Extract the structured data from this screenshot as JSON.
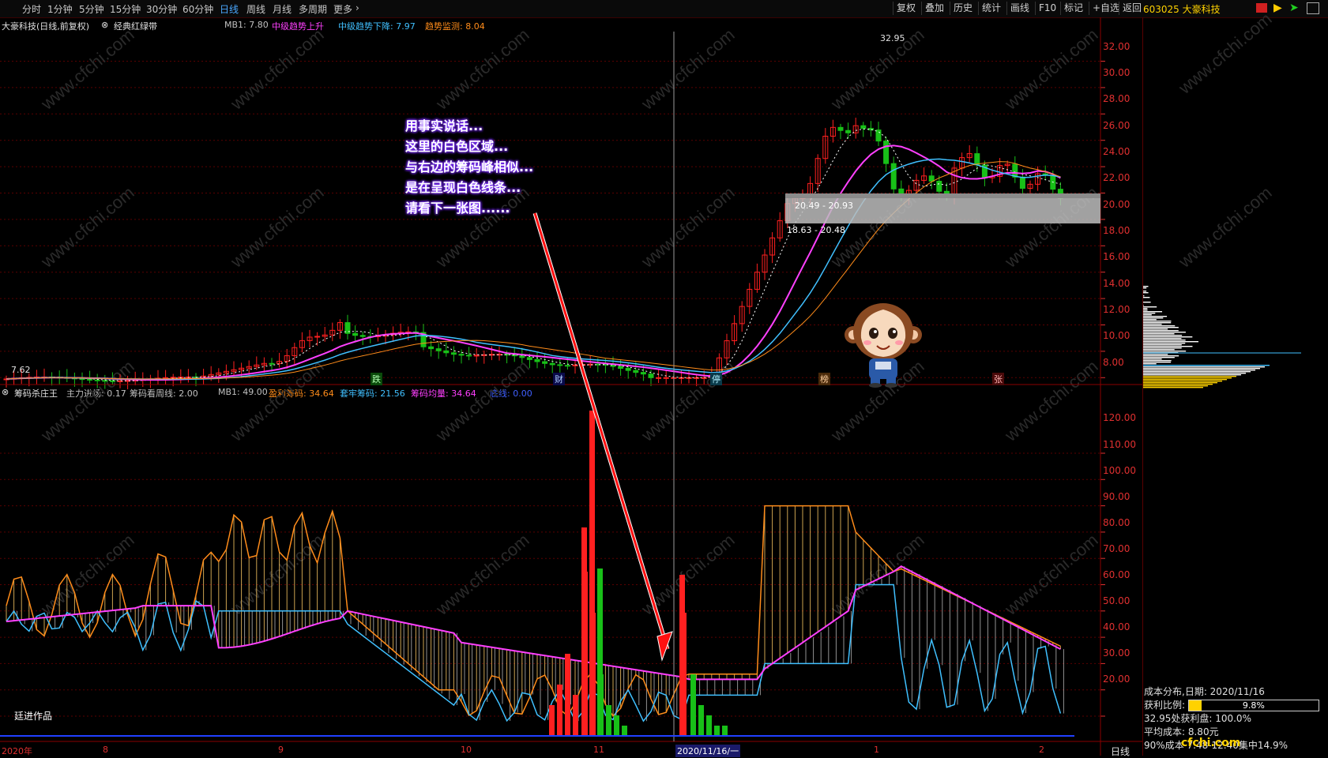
{
  "toolbar": {
    "timeframes": [
      "分时",
      "1分钟",
      "5分钟",
      "15分钟",
      "30分钟",
      "60分钟",
      "日线",
      "周线",
      "月线",
      "多周期",
      "更多"
    ],
    "active_timeframe": "日线",
    "right_buttons": [
      "复权",
      "叠加",
      "历史",
      "统计",
      "画线",
      "F10",
      "标记",
      "+自选",
      "返回"
    ],
    "stock": "603025 大豪科技"
  },
  "main_chart": {
    "title": "大豪科技(日线,前复权)",
    "indicator_name": "经典红绿带",
    "indicators": [
      {
        "label": "MB1: 7.80",
        "color": "#c0c0c0"
      },
      {
        "label": "中级趋势上升",
        "color": "#ff40ff"
      },
      {
        "label": "中级趋势下降: 7.97",
        "color": "#40c0ff"
      },
      {
        "label": "趋势监测: 8.04",
        "color": "#ff8c1a"
      }
    ],
    "y_labels": [
      "32.00",
      "30.00",
      "28.00",
      "26.00",
      "24.00",
      "22.00",
      "20.00",
      "18.00",
      "16.00",
      "14.00",
      "12.00",
      "10.00",
      "8.00"
    ],
    "high_label": "32.95",
    "low_label": "7.62",
    "range_label_1": "20.49 - 20.93",
    "range_label_2": "18.63 - 20.48",
    "marker_tags": [
      "跌",
      "财",
      "停",
      "榜",
      "张"
    ]
  },
  "sub_chart": {
    "title": "筹码杀庄王",
    "indicators": [
      {
        "label": "主力进场: 0.17",
        "color": "#c0c0c0"
      },
      {
        "label": "筹码看周线: 2.00",
        "color": "#c0c0c0"
      },
      {
        "label": "MB1: 49.00",
        "color": "#c0c0c0"
      },
      {
        "label": "盈利筹码: 34.64",
        "color": "#ff8c1a"
      },
      {
        "label": "套牢筹码: 21.56",
        "color": "#40c0ff"
      },
      {
        "label": "筹码均量: 34.64",
        "color": "#ff40ff"
      },
      {
        "label": "底线: 0.00",
        "color": "#4060ff"
      }
    ],
    "y_labels": [
      "120.00",
      "110.00",
      "100.00",
      "90.00",
      "80.00",
      "70.00",
      "60.00",
      "50.00",
      "40.00",
      "30.00",
      "20.00"
    ],
    "signature": "廷进作品"
  },
  "annotation": {
    "lines": [
      "用事实说话...",
      "这里的白色区域...",
      "与右边的筹码峰相似...",
      "是在呈现白色线条...",
      "请看下一张图......"
    ]
  },
  "date_axis": {
    "labels": [
      "2020年",
      "8",
      "9",
      "10",
      "11",
      "2020/11/16/一",
      "1",
      "2"
    ],
    "period": "日线"
  },
  "chip_panel": {
    "title": "成本分布,日期: 2020/11/16",
    "profit_ratio_label": "获利比例:",
    "profit_ratio": "9.8%",
    "profit_ratio_value": 0.098,
    "profit_at": "32.95处获利盘: 100.0%",
    "avg_cost": "平均成本: 8.80元",
    "concentration": "90%成本 7.48-12.40集中14.9%"
  },
  "watermark_text": "www.cfchi.com",
  "site_logo": "cfchi.com",
  "colors": {
    "up": "#ff2020",
    "down": "#18c018",
    "axis": "#e03030",
    "pink": "#ff40ff",
    "cyan": "#40c0ff",
    "orange": "#ff8c1a"
  }
}
